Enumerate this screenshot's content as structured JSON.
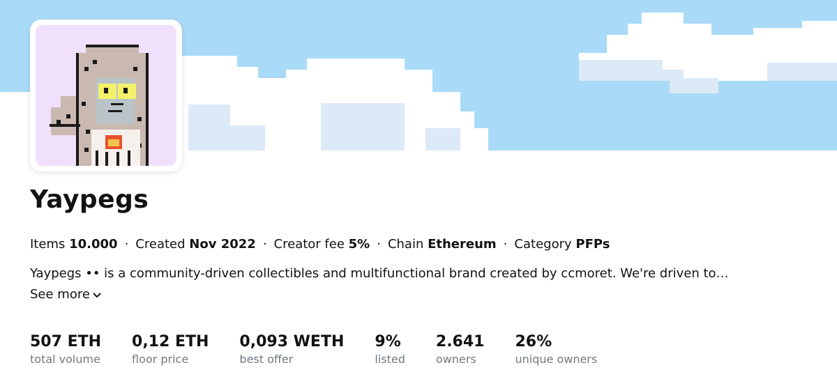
{
  "collection": {
    "name": "Yaypegs",
    "avatar_icon": "pixel-avatar-shark-hood",
    "banner_icon": "pixel-cloud-sky"
  },
  "details": [
    {
      "label": "Items",
      "value": "10.000"
    },
    {
      "label": "Created",
      "value": "Nov 2022"
    },
    {
      "label": "Creator fee",
      "value": "5%"
    },
    {
      "label": "Chain",
      "value": "Ethereum"
    },
    {
      "label": "Category",
      "value": "PFPs"
    }
  ],
  "description": "Yaypegs •• is a community-driven collectibles and multifunctional brand created by ccmoret. We're driven to…",
  "see_more_label": "See more",
  "stats": [
    {
      "value": "507 ETH",
      "label": "total volume"
    },
    {
      "value": "0,12 ETH",
      "label": "floor price"
    },
    {
      "value": "0,093 WETH",
      "label": "best offer"
    },
    {
      "value": "9%",
      "label": "listed"
    },
    {
      "value": "2.641",
      "label": "owners"
    },
    {
      "value": "26%",
      "label": "unique owners"
    }
  ],
  "colors": {
    "sky": "#a9daf7",
    "cloud": "#ffffff",
    "cloud_shade": "#dce9f7",
    "avatar_bg": "#f1e0fb",
    "muted_text": "#707a83"
  }
}
